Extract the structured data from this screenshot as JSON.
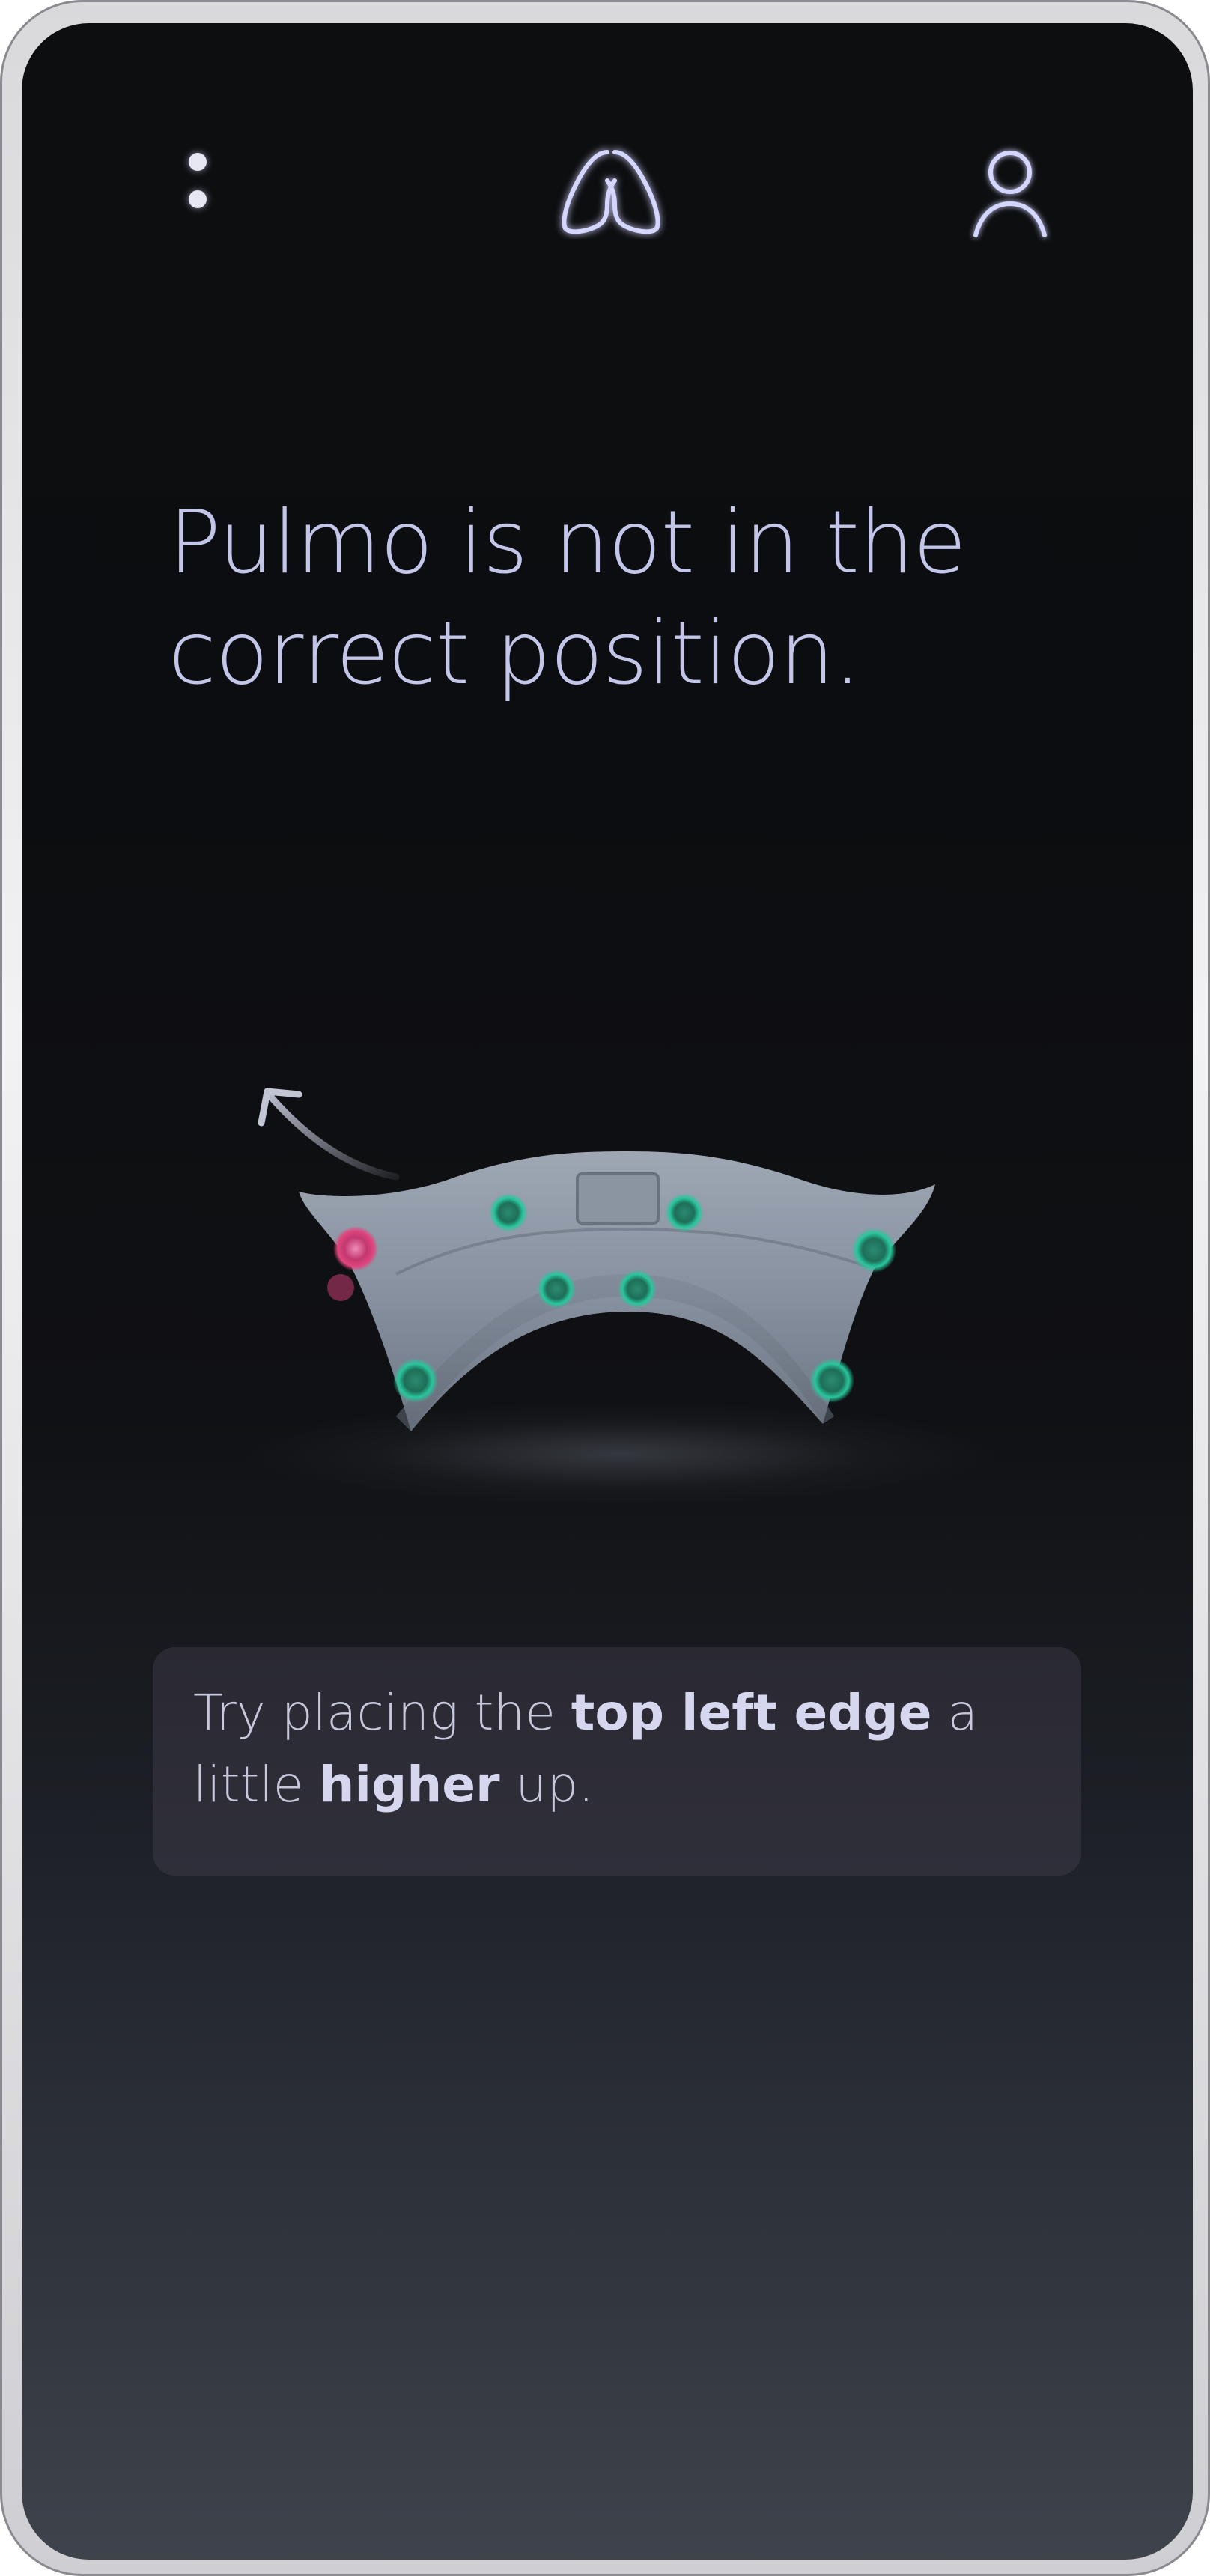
{
  "header": {
    "menu_icon": "more-vertical-icon",
    "logo_icon": "lungs-logo-icon",
    "profile_icon": "user-profile-icon"
  },
  "main": {
    "title_line1": "Pulmo is not in the",
    "title_line2": "correct position."
  },
  "device": {
    "image": "pulmo-device-illustration",
    "adjust_direction_icon": "curved-arrow-up-left-icon",
    "sensor_colors": {
      "ok": "#1fb58f",
      "error": "#d6407a"
    }
  },
  "hint": {
    "part1": "Try placing the ",
    "bold1": "top left edge",
    "part2": " a little ",
    "bold2": "higher",
    "part3": " up."
  },
  "colors": {
    "accent": "#c4c6e9",
    "background_top": "#0d0e10",
    "background_bottom": "#3e434c",
    "card": "#2d2d38"
  }
}
